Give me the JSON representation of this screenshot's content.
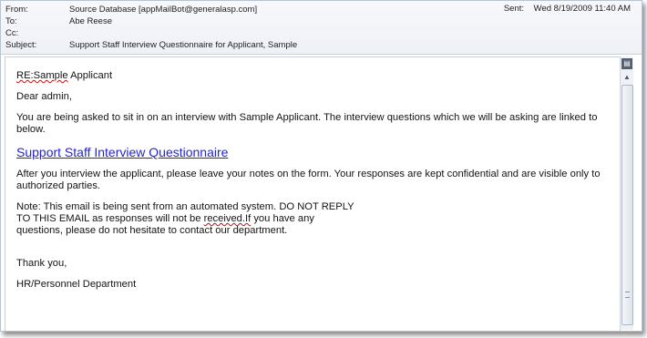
{
  "header": {
    "from_label": "From:",
    "from_value": "Source Database [appMailBot@generalasp.com]",
    "to_label": "To:",
    "to_value": "Abe Reese",
    "cc_label": "Cc:",
    "cc_value": "",
    "subject_label": "Subject:",
    "subject_value": "Support Staff Interview Questionnaire for Applicant, Sample",
    "sent_label": "Sent:",
    "sent_value": "Wed 8/19/2009 11:40 AM"
  },
  "message": {
    "re_prefix": "RE:Sample",
    "re_rest": " Applicant",
    "greeting": "Dear admin,",
    "intro": "You are being asked to sit in on an interview with Sample Applicant. The interview questions which we will be asking are linked to below.",
    "link_text": "Support Staff Interview Questionnaire",
    "after": "After you interview the applicant, please leave your notes on the form. Your responses are kept confidential and are visible only to authorized parties.",
    "note_line1": "Note: This email is being sent from an automated system. DO NOT REPLY",
    "note_line2_a": "TO THIS EMAIL as responses will not be ",
    "note_line2_squig": "received.If",
    "note_line2_b": " you have any",
    "note_line3": "questions, please do not hesitate to contact our department.",
    "thanks": "Thank you,",
    "signature": "HR/Personnel Department"
  },
  "icons": {
    "scroll_top": "page-icon",
    "scroll_up": "arrow-up-icon",
    "grip": "grip-icon"
  }
}
